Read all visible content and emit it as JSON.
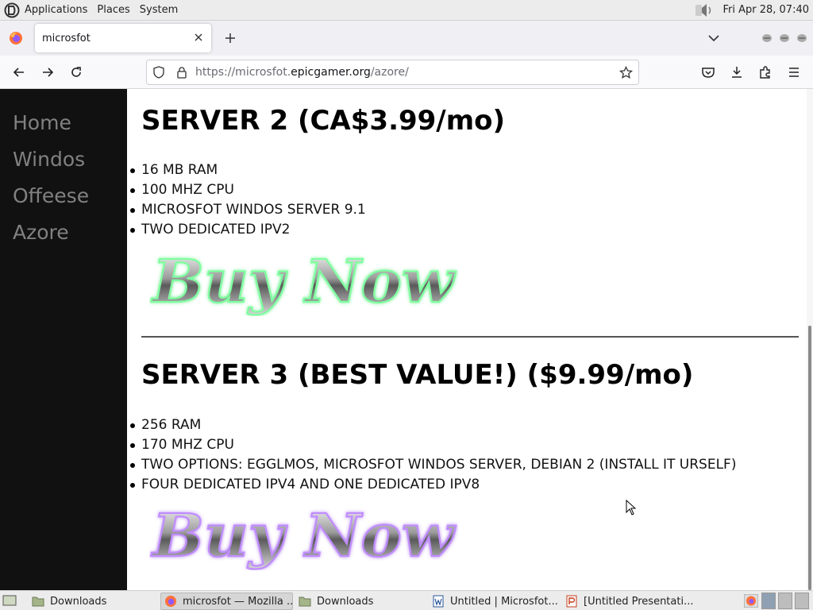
{
  "system_panel": {
    "menus": [
      "Applications",
      "Places",
      "System"
    ],
    "clock": "Fri Apr 28, 07:40"
  },
  "browser": {
    "tab_title": "microsfot",
    "url": {
      "prefix": "https://microsfot.",
      "domain": "epicgamer.org",
      "path": "/azore/"
    }
  },
  "sidenav": {
    "items": [
      "Home",
      "Windos",
      "Offeese",
      "Azore"
    ]
  },
  "servers": [
    {
      "title": "SERVER 2 (CA$3.99/mo)",
      "specs": [
        "16 MB RAM",
        "100 MHZ CPU",
        "MICROSFOT WINDOS SERVER 9.1",
        "TWO DEDICATED IPV2"
      ],
      "buy_label": "Buy Now"
    },
    {
      "title": "SERVER 3 (BEST VALUE!) ($9.99/mo)",
      "specs": [
        "256 RAM",
        "170 MHZ CPU",
        "TWO OPTIONS: EGGLMOS, MICROSFOT WINDOS SERVER, DEBIAN 2 (INSTALL IT URSELF)",
        "FOUR DEDICATED IPV4 AND ONE DEDICATED IPV8"
      ],
      "buy_label": "Buy Now"
    }
  ],
  "taskbar": {
    "tasks": [
      {
        "label": "Downloads",
        "icon": "folder-icon"
      },
      {
        "label": "microsfot — Mozilla ...",
        "icon": "firefox-icon"
      },
      {
        "label": "Downloads",
        "icon": "folder-icon"
      },
      {
        "label": "Untitled | Microsfot...",
        "icon": "word-doc-icon"
      },
      {
        "label": "[Untitled Presentati...",
        "icon": "presentation-icon"
      }
    ]
  },
  "colors": {
    "sidenav_bg": "#111111",
    "sidenav_text": "#818181",
    "panel_bg": "#ececec"
  }
}
